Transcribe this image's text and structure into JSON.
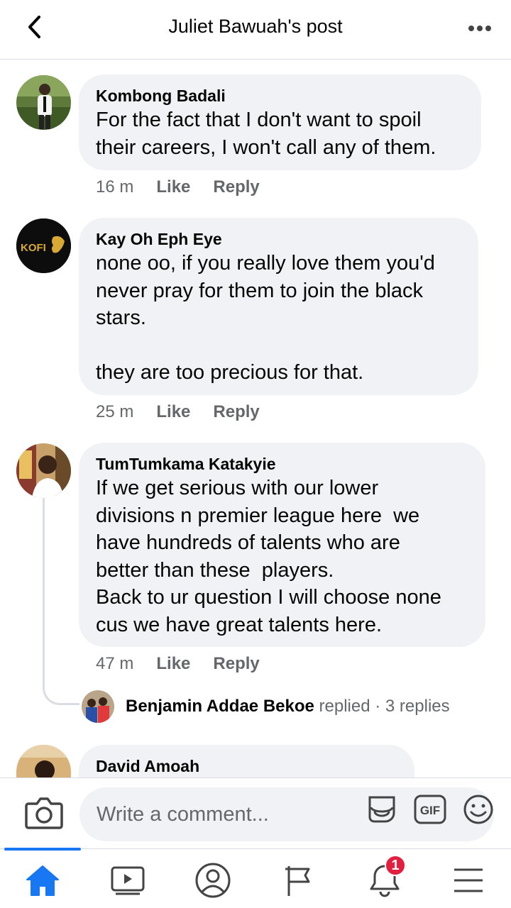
{
  "header": {
    "title": "Juliet Bawuah's post"
  },
  "comments": [
    {
      "author": "Kombong Badali",
      "text": "For the fact that I don't want to spoil\ntheir careers, I won't call any of them.",
      "time": "16 m",
      "like": "Like",
      "reply": "Reply"
    },
    {
      "author": "Kay Oh Eph Eye",
      "avatar_logo": "KOFI",
      "text": "none oo, if you really love them you'd\nnever pray for them to join the black\nstars.\n\nthey are too precious for that.",
      "time": "25 m",
      "like": "Like",
      "reply": "Reply"
    },
    {
      "author": "TumTumkama Katakyie",
      "text": "If we get serious with our lower\ndivisions n premier league here  we\nhave hundreds of talents who are\nbetter than these  players.\nBack to ur question I will choose none\ncus we have great talents here.",
      "time": "47 m",
      "like": "Like",
      "reply": "Reply"
    },
    {
      "author": "David Amoah"
    }
  ],
  "replies_summary": {
    "name": "Benjamin Addae Bekoe",
    "action": " replied",
    "count": " · 3 replies"
  },
  "composer": {
    "placeholder": "Write a comment...",
    "gif_label": "GIF"
  },
  "tabbar": {
    "notifications_badge": "1"
  },
  "colors": {
    "accent": "#1877f2",
    "bubble": "#f0f2f5",
    "secondary_text": "#65676b",
    "badge": "#e41e3f"
  }
}
